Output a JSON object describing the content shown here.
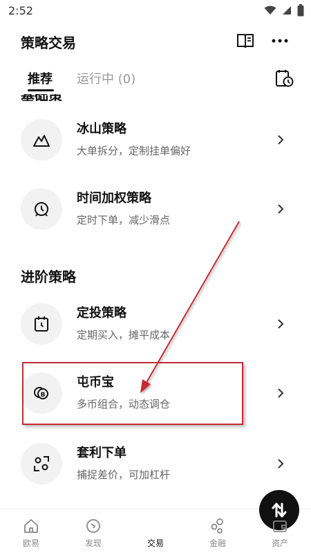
{
  "status": {
    "time": "2:52"
  },
  "header": {
    "title": "策略交易"
  },
  "tabs": {
    "recommended": "推荐",
    "running": "运行中 (0)"
  },
  "strategies": [
    {
      "title": "冰山策略",
      "subtitle": "大单拆分，定制挂单偏好",
      "icon": "mountain-icon"
    },
    {
      "title": "时间加权策略",
      "subtitle": "定时下单，减少滑点",
      "icon": "clock-icon"
    }
  ],
  "advanced": {
    "heading": "进阶策略",
    "items": [
      {
        "title": "定投策略",
        "subtitle": "定期买入，摊平成本",
        "icon": "calendar-icon"
      },
      {
        "title": "屯币宝",
        "subtitle": "多币组合，动态调仓",
        "icon": "coins-icon"
      },
      {
        "title": "套利下单",
        "subtitle": "捕捉差价，可加杠杆",
        "icon": "scan-icon"
      }
    ]
  },
  "nav": {
    "items": [
      {
        "label": "欧易",
        "icon": "home-icon"
      },
      {
        "label": "发现",
        "icon": "discover-icon"
      },
      {
        "label": "交易",
        "icon": "trade-icon"
      },
      {
        "label": "金融",
        "icon": "finance-icon"
      },
      {
        "label": "资产",
        "icon": "wallet-icon"
      }
    ],
    "active": "交易"
  },
  "colors": {
    "annotation": "#c52a33",
    "accent": "#111111"
  }
}
